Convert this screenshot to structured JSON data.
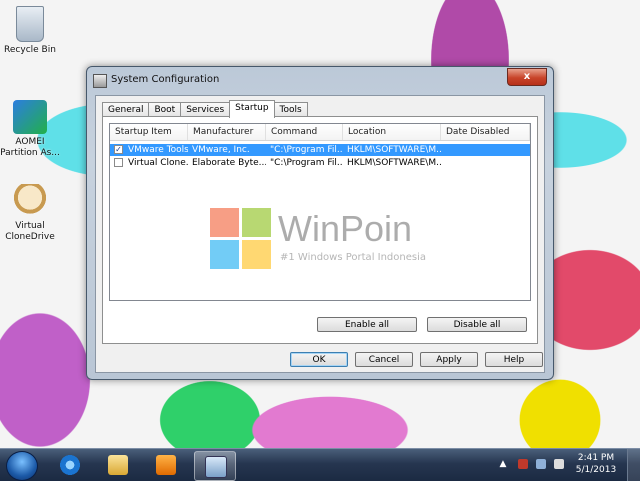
{
  "desktop": {
    "icons": [
      {
        "label": "Recycle Bin"
      },
      {
        "label": "AOMEI Partition As..."
      },
      {
        "label": "Virtual CloneDrive"
      }
    ]
  },
  "window": {
    "title": "System Configuration",
    "close_label": "x",
    "tabs": [
      "General",
      "Boot",
      "Services",
      "Startup",
      "Tools"
    ],
    "active_tab": "Startup",
    "columns": [
      "Startup Item",
      "Manufacturer",
      "Command",
      "Location",
      "Date Disabled"
    ],
    "rows": [
      {
        "checked": true,
        "item": "VMware Tools",
        "manufacturer": "VMware, Inc.",
        "command": "\"C:\\Program Fil...",
        "location": "HKLM\\SOFTWARE\\M...",
        "date_disabled": ""
      },
      {
        "checked": false,
        "item": "Virtual Clone...",
        "manufacturer": "Elaborate Byte...",
        "command": "\"C:\\Program Fil...",
        "location": "HKLM\\SOFTWARE\\M...",
        "date_disabled": ""
      }
    ],
    "enable_all": "Enable all",
    "disable_all": "Disable all",
    "ok": "OK",
    "cancel": "Cancel",
    "apply": "Apply",
    "help": "Help"
  },
  "watermark": {
    "title": "WinPoin",
    "subtitle": "#1 Windows Portal Indonesia",
    "colors": [
      "#f25022",
      "#7fba00",
      "#00a4ef",
      "#ffb900"
    ]
  },
  "taskbar": {
    "time": "2:41 PM",
    "date": "5/1/2013",
    "tray_arrow": "▲",
    "apps": [
      "internet-explorer-icon",
      "file-explorer-icon",
      "media-player-icon",
      "msconfig-icon"
    ]
  },
  "colors": {
    "selection": "#3399ff",
    "taskbar": "#263650"
  }
}
